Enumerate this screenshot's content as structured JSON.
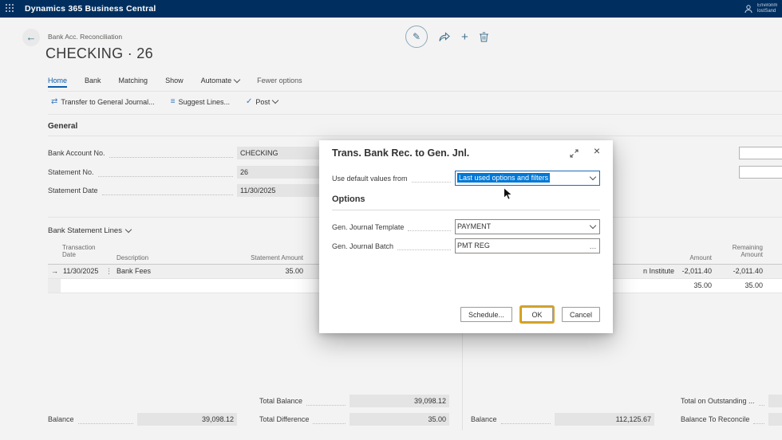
{
  "colors": {
    "topbar_bg": "#002f5f",
    "accent": "#0078d7",
    "selection_bg": "#0078d7",
    "ok_focus_ring": "#d8a420",
    "active_tab": "#0b5cab"
  },
  "icons": {
    "back": "←",
    "edit": "✎",
    "plus": "+",
    "transfer": "⇄",
    "suggest": "≡",
    "post": "✓",
    "row_arrow": "→",
    "ellipsis_v": "⋮",
    "more": "…",
    "close": "×"
  },
  "topbar": {
    "app_title": "Dynamics 365 Business Central",
    "env_line1": "Environm",
    "env_line2": "lostSand"
  },
  "header": {
    "breadcrumb": "Bank Acc. Reconciliation",
    "title": "CHECKING · 26"
  },
  "menu": {
    "tabs": [
      "Home",
      "Bank",
      "Matching",
      "Show"
    ],
    "automate": "Automate",
    "fewer_options": "Fewer options"
  },
  "actions": {
    "transfer": "Transfer to General Journal...",
    "suggest": "Suggest Lines...",
    "post": "Post"
  },
  "general": {
    "heading": "General",
    "bank_account_label": "Bank Account No.",
    "bank_account_value": "CHECKING",
    "statement_no_label": "Statement No.",
    "statement_no_value": "26",
    "statement_date_label": "Statement Date",
    "statement_date_value": "11/30/2025"
  },
  "lines": {
    "heading": "Bank Statement Lines",
    "col_transaction_date": "Transaction Date",
    "col_description": "Description",
    "col_statement_amount": "Statement Amount",
    "col_amount": "Amount",
    "col_remaining": "Remaining Amount",
    "row1": {
      "date": "11/30/2025",
      "description": "Bank Fees",
      "statement_amount": "35.00"
    },
    "right_row1": {
      "description": "n Institute",
      "amount": "-2,011.40",
      "remaining": "-2,011.40"
    },
    "right_row2": {
      "amount": "35.00",
      "remaining": "35.00"
    }
  },
  "totals": {
    "balance_left_label": "Balance",
    "balance_left_value": "39,098.12",
    "total_balance_label": "Total Balance",
    "total_balance_value": "39,098.12",
    "total_difference_label": "Total Difference",
    "total_difference_value": "35.00",
    "balance_right_label": "Balance",
    "balance_right_value": "112,125.67",
    "outstanding_label": "Total on Outstanding ...",
    "reconcile_label": "Balance To Reconcile"
  },
  "dialog": {
    "title": "Trans. Bank Rec. to Gen. Jnl.",
    "use_default_label": "Use default values from",
    "use_default_value": "Last used options and filters",
    "options_heading": "Options",
    "template_label": "Gen. Journal Template",
    "template_value": "PAYMENT",
    "batch_label": "Gen. Journal Batch",
    "batch_value": "PMT REG",
    "schedule_button": "Schedule...",
    "ok_button": "OK",
    "cancel_button": "Cancel"
  }
}
